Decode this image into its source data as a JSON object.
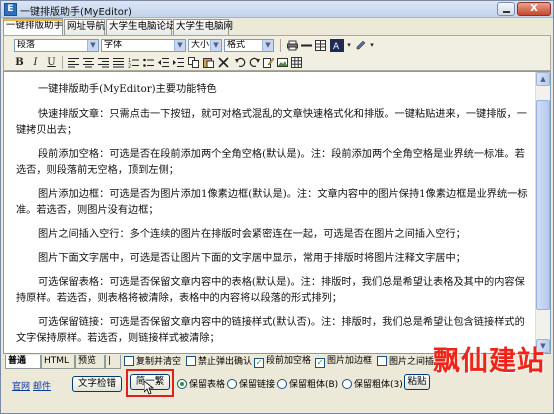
{
  "window": {
    "title": "一键排版助手(MyEditor)",
    "close_label": "X"
  },
  "tabs": [
    {
      "label": "一键排版助手",
      "active": true
    },
    {
      "label": "网址导航",
      "active": false
    },
    {
      "label": "大学生电脑论坛",
      "active": false
    },
    {
      "label": "大学生电脑网",
      "active": false
    }
  ],
  "toolbar": {
    "paragraph_select": "段落",
    "font_select": "字体",
    "size_select": "大小",
    "format_select": "格式",
    "bold": "B",
    "italic": "I",
    "underline": "U"
  },
  "editor": {
    "paragraphs": [
      "一键排版助手(MyEditor)主要功能特色",
      "快速排版文章：只需点击一下按钮，就可对格式混乱的文章快速格式化和排版。一键粘贴进来，一键排版，一键拷贝出去；",
      "段前添加空格：可选是否在段前添加两个全角空格(默认是)。注：段前添加两个全角空格是业界统一标准。若选否，则段落前无空格，顶到左侧；",
      "图片添加边框：可选是否为图片添加1像素边框(默认是)。注：文章内容中的图片保持1像素边框是业界统一标准。若选否，则图片没有边框；",
      "图片之间插入空行：多个连续的图片在排版时会紧密连在一起，可选是否在图片之间插入空行；",
      "图片下面文字居中，可选是否让图片下面的文字居中显示，常用于排版时将图片注释文字居中；",
      "可选保留表格：可选是否保留文章内容中的表格(默认是)。注：排版时，我们总是希望让表格及其中的内容保持原样。若选否，则表格将被清除，表格中的内容将以段落的形式排列；",
      "可选保留链接：可选是否保留文章内容中的链接样式(默认否)。注：排版时，我们总是希望让包含链接样式的文字保持原样。若选否，则链接样式被清除；"
    ]
  },
  "bottom": {
    "view_tabs": [
      "普通",
      "HTML",
      "预览"
    ],
    "checkboxes": [
      {
        "label": "复制并清空",
        "checked": false
      },
      {
        "label": "禁止弹出确认",
        "checked": false
      },
      {
        "label": "段前加空格",
        "checked": true
      },
      {
        "label": "图片加边框",
        "checked": true
      },
      {
        "label": "图片之间插入",
        "checked": false
      }
    ],
    "links": {
      "official": "官网",
      "mail": "邮件"
    },
    "buttons": {
      "check": "文字检错",
      "one_click": "简一繁",
      "paste": "粘贴"
    },
    "radios": [
      {
        "label": "保留表格",
        "checked": true
      },
      {
        "label": "保留链接",
        "checked": false
      },
      {
        "label": "保留粗体(B)",
        "checked": false
      },
      {
        "label": "保留粗体(3)",
        "checked": false
      }
    ]
  },
  "watermark": "飘仙建站"
}
